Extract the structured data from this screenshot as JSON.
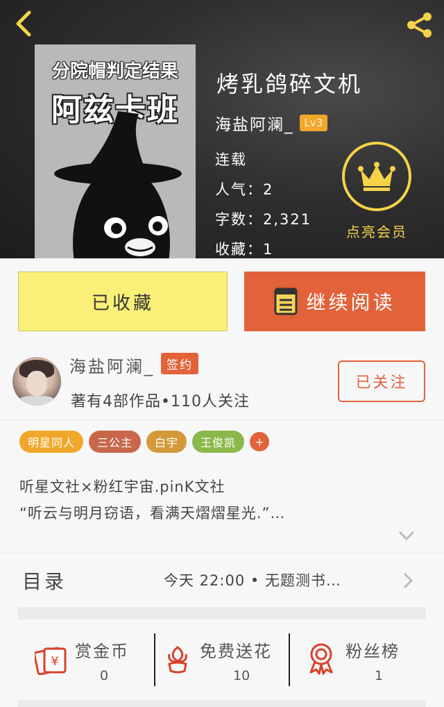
{
  "cover": {
    "line1": "分院帽判定结果",
    "line2": "阿兹卡班"
  },
  "book": {
    "title": "烤乳鸽碎文机",
    "author": "海盐阿澜_",
    "level": "Lv3",
    "status": "连载",
    "popularity": "人气：2",
    "word_count": "字数：2,321",
    "favorites": "收藏：1"
  },
  "vip": {
    "label": "点亮会员",
    "color": "#f5d24a"
  },
  "actions": {
    "favorited_label": "已收藏",
    "read_label": "继续阅读"
  },
  "author_card": {
    "name": "海盐阿澜_",
    "badge": "签约",
    "stats": "著有4部作品•110人关注",
    "follow_label": "已关注"
  },
  "tags": [
    {
      "label": "明星同人",
      "color": "#f0a72a"
    },
    {
      "label": "三公主",
      "color": "#c8674a"
    },
    {
      "label": "白宇",
      "color": "#d49a3a"
    },
    {
      "label": "王俊凯",
      "color": "#8bb84a"
    }
  ],
  "tag_add_label": "+",
  "synopsis": {
    "line1": "听星文社×粉红宇宙.pinK文社",
    "line2": "“听云与明月窃语，看满天熠熠星光.”…"
  },
  "toc": {
    "label": "目录",
    "latest": "今天 22:00 • 无题测书…"
  },
  "stats": [
    {
      "label": "赏金币",
      "value": "0",
      "icon": "coin-envelope-icon"
    },
    {
      "label": "免费送花",
      "value": "10",
      "icon": "flower-icon"
    },
    {
      "label": "粉丝榜",
      "value": "1",
      "icon": "medal-icon"
    }
  ],
  "accent_color": "#e2623a"
}
